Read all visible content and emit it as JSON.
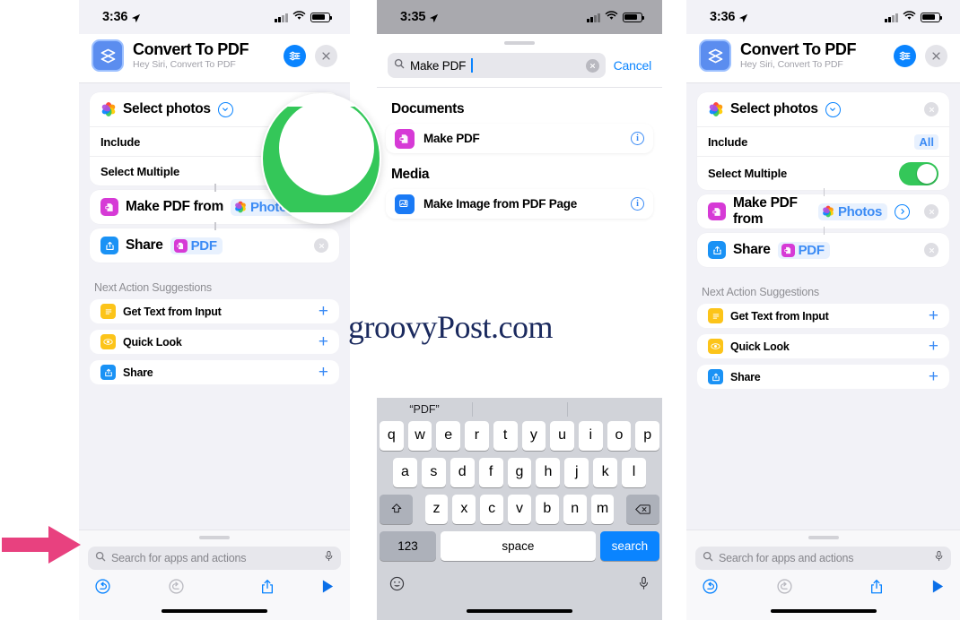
{
  "watermark": "groovyPost.com",
  "colors": {
    "accent_blue": "#0a84ff",
    "toggle_green": "#34c759",
    "pdf_magenta": "#d63ad6",
    "arrow_pink": "#e8417f",
    "panel_bg": "#f2f2f7",
    "watermark_navy": "#1b2a5e"
  },
  "panel1": {
    "status": {
      "time": "3:36",
      "location_icon": "location-arrow",
      "signal": "cellular-bars",
      "wifi": "wifi-icon",
      "battery": "battery-icon"
    },
    "header": {
      "app_icon": "shortcuts-icon",
      "title": "Convert To PDF",
      "subtitle": "Hey Siri, Convert To PDF",
      "settings_button": "sliders-icon",
      "close_button": "close-icon"
    },
    "actions": [
      {
        "icon": "photos-icon",
        "label": "Select photos",
        "expand": "chevron-down-circle",
        "subrows": [
          {
            "label": "Include",
            "value": ""
          },
          {
            "label": "Select Multiple",
            "value": ""
          }
        ]
      },
      {
        "icon": "pdf-icon",
        "label": "Make PDF from",
        "token_icon": "photos-icon",
        "token": "Photos"
      },
      {
        "icon": "share-icon",
        "label": "Share",
        "token_icon": "pdf-icon",
        "token": "PDF"
      }
    ],
    "suggestions_title": "Next Action Suggestions",
    "suggestions": [
      {
        "icon": "text-icon",
        "label": "Get Text from Input",
        "add": "+"
      },
      {
        "icon": "eye-icon",
        "label": "Quick Look",
        "add": "+"
      },
      {
        "icon": "share-icon",
        "label": "Share",
        "add": "+"
      }
    ],
    "bottom": {
      "search_placeholder": "Search for apps and actions",
      "search_icon": "search-icon",
      "mic_icon": "microphone-icon",
      "undo": "undo-icon",
      "redo": "redo-icon",
      "share": "share-up-icon",
      "play": "play-icon"
    }
  },
  "panel2": {
    "status": {
      "time": "3:35",
      "location_icon": "location-arrow"
    },
    "search": {
      "value": "Make PDF",
      "search_icon": "search-icon",
      "clear_icon": "clear-icon",
      "cancel_label": "Cancel"
    },
    "sections": [
      {
        "header": "Documents",
        "results": [
          {
            "icon": "pdf-icon",
            "label": "Make PDF",
            "info": "info-icon"
          }
        ]
      },
      {
        "header": "Media",
        "results": [
          {
            "icon": "image-pdf-icon",
            "label": "Make Image from PDF Page",
            "info": "info-icon"
          }
        ]
      }
    ],
    "keyboard": {
      "suggestions": [
        "“PDF”",
        "",
        ""
      ],
      "row1": [
        "q",
        "w",
        "e",
        "r",
        "t",
        "y",
        "u",
        "i",
        "o",
        "p"
      ],
      "row2": [
        "a",
        "s",
        "d",
        "f",
        "g",
        "h",
        "j",
        "k",
        "l"
      ],
      "row3": [
        "z",
        "x",
        "c",
        "v",
        "b",
        "n",
        "m"
      ],
      "shift": "shift-icon",
      "backspace": "backspace-icon",
      "numbers_label": "123",
      "space_label": "space",
      "return_label": "search",
      "emoji": "emoji-icon",
      "dictate": "microphone-icon"
    }
  },
  "panel3": {
    "status": {
      "time": "3:36",
      "location_icon": "location-arrow"
    },
    "header": {
      "app_icon": "shortcuts-icon",
      "title": "Convert To PDF",
      "subtitle": "Hey Siri, Convert To PDF",
      "settings_button": "sliders-icon",
      "close_button": "close-icon"
    },
    "actions": [
      {
        "icon": "photos-icon",
        "label": "Select photos",
        "expand": "chevron-down-circle",
        "remove": "remove-icon",
        "subrows": [
          {
            "label": "Include",
            "value": "All"
          },
          {
            "label": "Select Multiple",
            "value": "toggle-on"
          }
        ]
      },
      {
        "icon": "pdf-icon",
        "label": "Make PDF from",
        "token_icon": "photos-icon",
        "token": "Photos",
        "chevron": "chevron-right-circle",
        "remove": "remove-icon"
      },
      {
        "icon": "share-icon",
        "label": "Share",
        "token_icon": "pdf-icon",
        "token": "PDF",
        "remove": "remove-icon"
      }
    ],
    "suggestions_title": "Next Action Suggestions",
    "suggestions": [
      {
        "icon": "text-icon",
        "label": "Get Text from Input",
        "add": "+"
      },
      {
        "icon": "eye-icon",
        "label": "Quick Look",
        "add": "+"
      },
      {
        "icon": "share-icon",
        "label": "Share",
        "add": "+"
      }
    ],
    "bottom": {
      "search_placeholder": "Search for apps and actions",
      "search_icon": "search-icon",
      "mic_icon": "microphone-icon",
      "undo": "undo-icon",
      "redo": "redo-icon",
      "share": "share-up-icon",
      "play": "play-icon"
    }
  },
  "annotations": {
    "magnifier": "magnified-toggle-callout",
    "arrow": "pink-arrow-pointing-to-search"
  }
}
